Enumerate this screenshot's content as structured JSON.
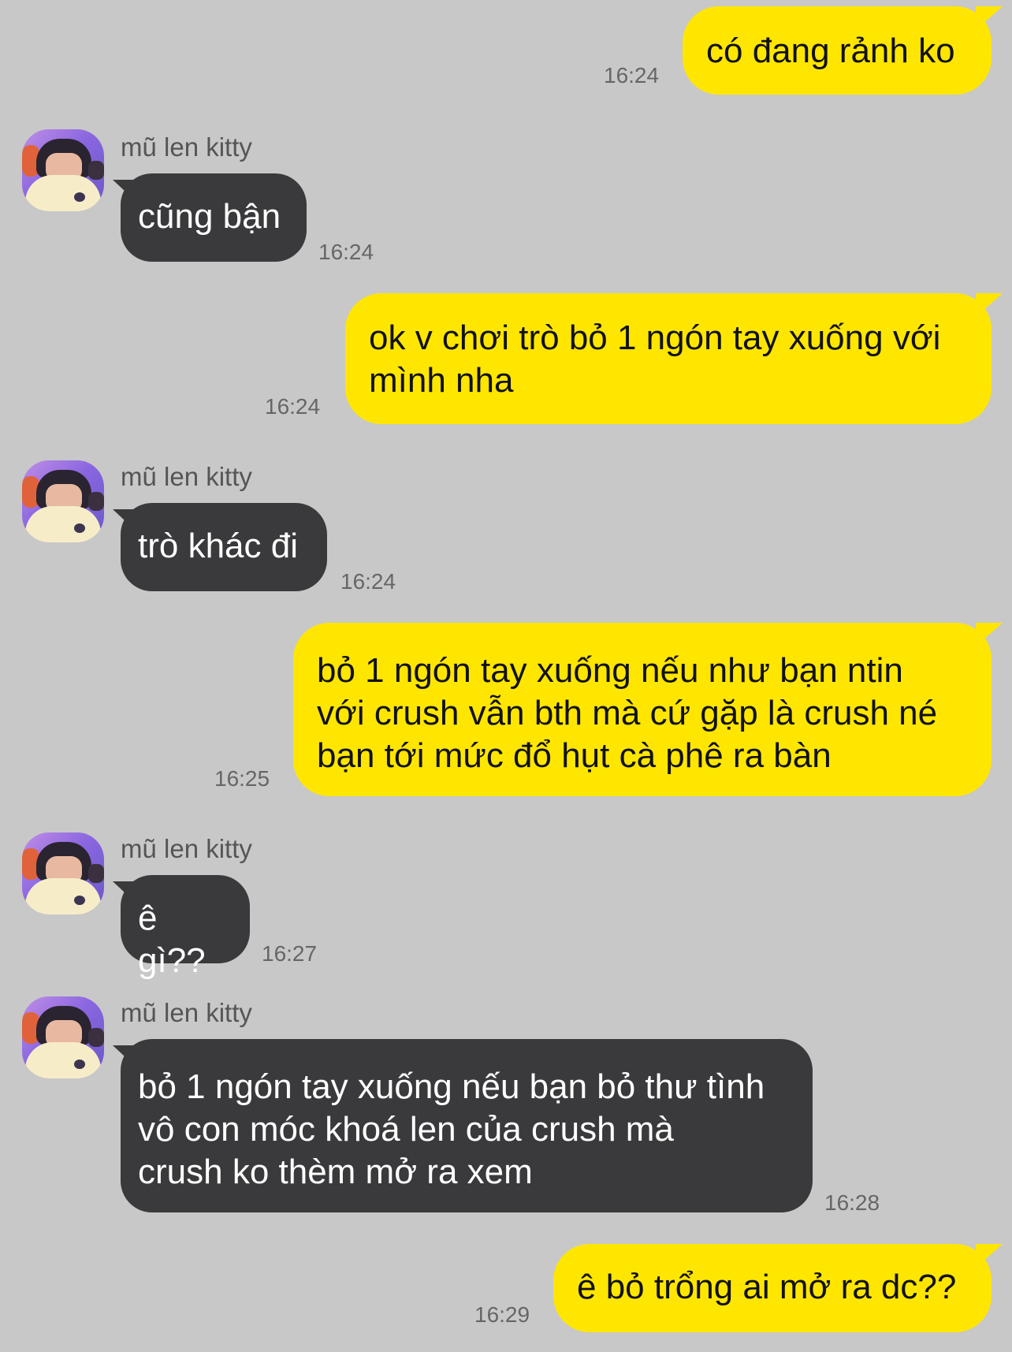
{
  "contact": {
    "name": "mũ len kitty",
    "avatar_icon": "avatar-photo-icon"
  },
  "colors": {
    "background": "#c8c8c8",
    "outgoing_bubble": "#ffe600",
    "incoming_bubble": "#3a3a3c"
  },
  "messages": [
    {
      "direction": "out",
      "text": "có đang rảnh ko",
      "time": "16:24"
    },
    {
      "direction": "in",
      "sender": "mũ len kitty",
      "text": "cũng bận",
      "time": "16:24"
    },
    {
      "direction": "out",
      "lines": [
        "ok v chơi trò bỏ 1 ngón tay xuống với",
        "mình nha"
      ],
      "time": "16:24"
    },
    {
      "direction": "in",
      "sender": "mũ len kitty",
      "text": "trò khác đi",
      "time": "16:24"
    },
    {
      "direction": "out",
      "lines": [
        "bỏ 1 ngón tay xuống nếu như bạn ntin",
        "với crush vẫn bth mà cứ gặp là crush né",
        "bạn tới mức đổ hụt cà phê ra bàn"
      ],
      "time": "16:25"
    },
    {
      "direction": "in",
      "sender": "mũ len kitty",
      "text": "ê gì??",
      "time": "16:27"
    },
    {
      "direction": "in",
      "sender": "mũ len kitty",
      "lines": [
        "bỏ 1 ngón tay xuống nếu bạn bỏ thư tình",
        "vô con móc khoá len của crush mà",
        "crush ko thèm mở ra xem"
      ],
      "time": "16:28"
    },
    {
      "direction": "out",
      "text": "ê bỏ trổng ai mở ra dc??",
      "time": "16:29"
    }
  ]
}
